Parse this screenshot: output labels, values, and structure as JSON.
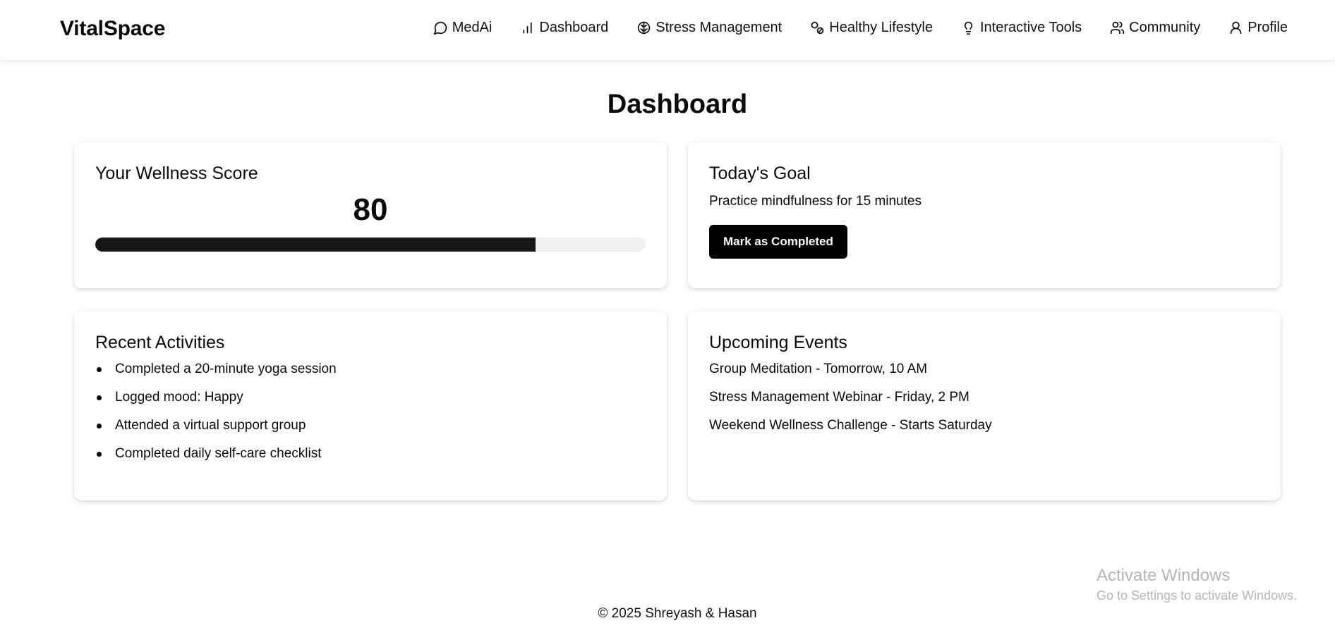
{
  "header": {
    "logo": "VitalSpace",
    "nav": [
      {
        "label": "MedAi",
        "icon": "chat-bubble-icon"
      },
      {
        "label": "Dashboard",
        "icon": "bar-chart-icon"
      },
      {
        "label": "Stress Management",
        "icon": "brain-icon"
      },
      {
        "label": "Healthy Lifestyle",
        "icon": "medicine-icon"
      },
      {
        "label": "Interactive Tools",
        "icon": "lightbulb-icon"
      },
      {
        "label": "Community",
        "icon": "users-icon"
      },
      {
        "label": "Profile",
        "icon": "user-icon"
      }
    ]
  },
  "page": {
    "title": "Dashboard"
  },
  "wellness": {
    "title": "Your Wellness Score",
    "score": "80",
    "progress_percent": 80
  },
  "goal": {
    "title": "Today's Goal",
    "text": "Practice mindfulness for 15 minutes",
    "button_label": "Mark as Completed"
  },
  "activities": {
    "title": "Recent Activities",
    "items": [
      "Completed a 20-minute yoga session",
      "Logged mood: Happy",
      "Attended a virtual support group",
      "Completed daily self-care checklist"
    ]
  },
  "events": {
    "title": "Upcoming Events",
    "items": [
      "Group Meditation - Tomorrow, 10 AM",
      "Stress Management Webinar - Friday, 2 PM",
      "Weekend Wellness Challenge - Starts Saturday"
    ]
  },
  "watermark": {
    "title": "Activate Windows",
    "subtitle": "Go to Settings to activate Windows."
  },
  "footer": {
    "text": "© 2025 Shreyash & Hasan"
  },
  "colors": {
    "progress_fill": "#171717",
    "progress_track": "#f1f1f1",
    "button_bg": "#000000"
  }
}
